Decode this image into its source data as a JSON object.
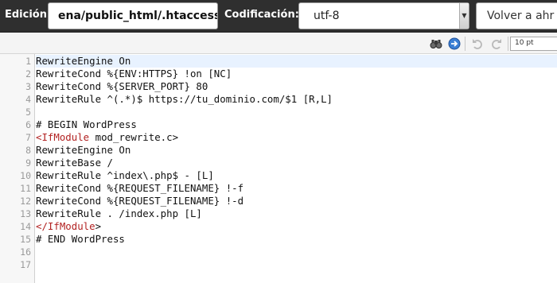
{
  "header": {
    "edit_label": "Edición:",
    "file_path": "ena/public_html/.htaccess",
    "encoding_label": "Codificación:",
    "encoding_value": "utf-8",
    "back_button": "Volver a ahr"
  },
  "toolbar": {
    "font_size": "10 pt",
    "icons": [
      "search-icon",
      "goto-line-icon",
      "undo-icon",
      "redo-icon"
    ]
  },
  "editor": {
    "line_numbers": [
      "1",
      "2",
      "3",
      "4",
      "5",
      "6",
      "7",
      "8",
      "9",
      "10",
      "11",
      "12",
      "13",
      "14",
      "15",
      "16",
      "17"
    ],
    "lines": [
      "RewriteEngine On",
      "RewriteCond %{ENV:HTTPS} !on [NC]",
      "RewriteCond %{SERVER_PORT} 80",
      "RewriteRule ^(.*)$ https://tu_dominio.com/$1 [R,L]",
      "",
      "# BEGIN WordPress",
      "<IfModule mod_rewrite.c>",
      "RewriteEngine On",
      "RewriteBase /",
      "RewriteRule ^index\\.php$ - [L]",
      "RewriteCond %{REQUEST_FILENAME} !-f",
      "RewriteCond %{REQUEST_FILENAME} !-d",
      "RewriteRule . /index.php [L]",
      "</IfModule>",
      "# END WordPress",
      "",
      ""
    ],
    "tag_color": "#b22222"
  }
}
